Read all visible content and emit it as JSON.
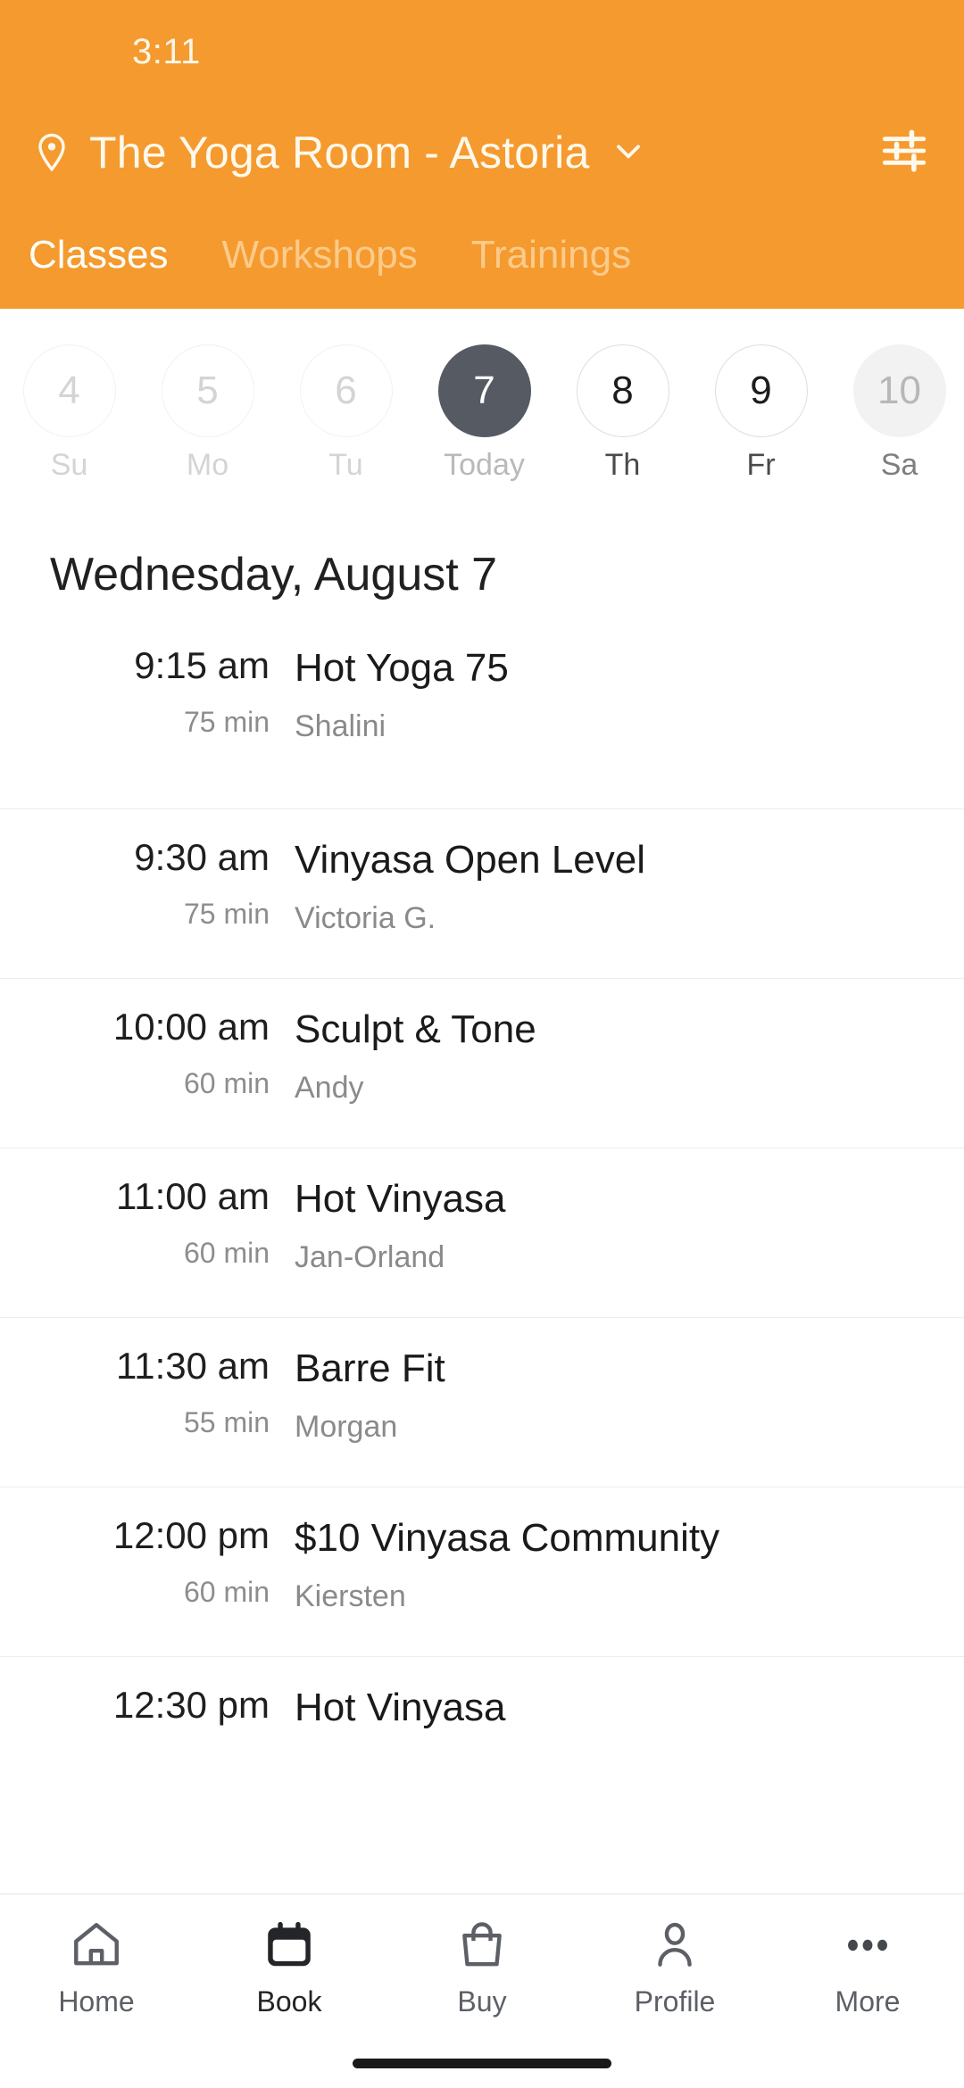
{
  "status_bar": {
    "time": "3:11"
  },
  "header": {
    "location_name": "The Yoga Room - Astoria",
    "pin_icon": "location-pin-icon",
    "chevron_icon": "chevron-down-icon",
    "filter_icon": "tune-filter-icon",
    "accent_color": "#F59A2E",
    "tabs": [
      {
        "label": "Classes",
        "active": true
      },
      {
        "label": "Workshops",
        "active": false
      },
      {
        "label": "Trainings",
        "active": false
      }
    ]
  },
  "date_strip": {
    "selected_color": "#565A63",
    "days": [
      {
        "num": "4",
        "dow": "Su",
        "state": "past"
      },
      {
        "num": "5",
        "dow": "Mo",
        "state": "past"
      },
      {
        "num": "6",
        "dow": "Tu",
        "state": "past"
      },
      {
        "num": "7",
        "dow": "Today",
        "state": "today"
      },
      {
        "num": "8",
        "dow": "Th",
        "state": "future"
      },
      {
        "num": "9",
        "dow": "Fr",
        "state": "future"
      },
      {
        "num": "10",
        "dow": "Sa",
        "state": "pressed"
      }
    ]
  },
  "schedule": {
    "day_title": "Wednesday, August 7",
    "classes": [
      {
        "time": "9:15 am",
        "duration": "75 min",
        "name": "Hot Yoga 75",
        "teacher": "Shalini"
      },
      {
        "time": "9:30 am",
        "duration": "75 min",
        "name": "Vinyasa Open Level",
        "teacher": "Victoria G."
      },
      {
        "time": "10:00 am",
        "duration": "60 min",
        "name": "Sculpt & Tone",
        "teacher": "Andy"
      },
      {
        "time": "11:00 am",
        "duration": "60 min",
        "name": "Hot Vinyasa",
        "teacher": "Jan-Orland"
      },
      {
        "time": "11:30 am",
        "duration": "55 min",
        "name": "Barre Fit",
        "teacher": "Morgan"
      },
      {
        "time": "12:00 pm",
        "duration": "60 min",
        "name": "$10 Vinyasa Community",
        "teacher": "Kiersten"
      },
      {
        "time": "12:30 pm",
        "duration": "",
        "name": "Hot Vinyasa",
        "teacher": ""
      }
    ]
  },
  "bottom_nav": {
    "items": [
      {
        "label": "Home",
        "icon": "house-icon",
        "active": false
      },
      {
        "label": "Book",
        "icon": "calendar-icon",
        "active": true
      },
      {
        "label": "Buy",
        "icon": "shopping-bag-icon",
        "active": false
      },
      {
        "label": "Profile",
        "icon": "person-icon",
        "active": false
      },
      {
        "label": "More",
        "icon": "ellipsis-icon",
        "active": false
      }
    ]
  }
}
